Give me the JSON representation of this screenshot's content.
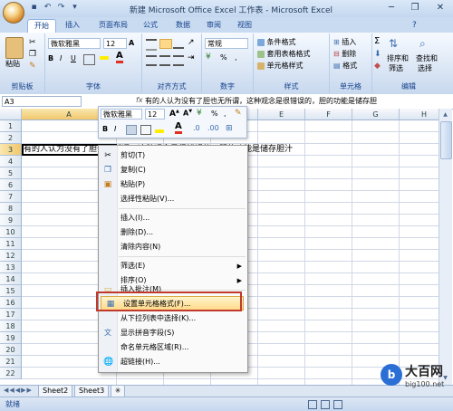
{
  "window": {
    "title": "新建 Microsoft Office Excel 工作表 - Microsoft Excel"
  },
  "qat": [
    "save-icon",
    "undo-icon",
    "redo-icon",
    "dropdown-icon"
  ],
  "tabs": [
    {
      "label": "开始",
      "active": true
    },
    {
      "label": "插入"
    },
    {
      "label": "页面布局"
    },
    {
      "label": "公式"
    },
    {
      "label": "数据"
    },
    {
      "label": "审阅"
    },
    {
      "label": "视图"
    }
  ],
  "ribbon": {
    "clipboard": {
      "label": "剪贴板",
      "paste": "粘贴"
    },
    "font": {
      "label": "字体",
      "name": "微软雅黑",
      "size": "12",
      "bold": "B",
      "italic": "I",
      "underline": "U",
      "grow": "A",
      "shrink": "A"
    },
    "alignment": {
      "label": "对齐方式"
    },
    "number": {
      "label": "数字",
      "format": "常规",
      "percent": "%",
      "comma": ","
    },
    "styles": {
      "label": "样式",
      "cond": "条件格式",
      "table": "套用表格格式",
      "cell": "单元格样式"
    },
    "cells": {
      "label": "单元格",
      "insert": "插入",
      "delete": "删除",
      "format": "格式"
    },
    "editing": {
      "label": "编辑",
      "sort": "排序和",
      "sort2": "筛选",
      "find": "查找和",
      "find2": "选择",
      "sigma": "Σ"
    }
  },
  "formula_bar": {
    "namebox": "A3",
    "fx": "fx",
    "content": "有的人认为没有了胆也无所谓，这种观念是很错误的，胆的功能是储存胆"
  },
  "grid": {
    "columns": [
      "A",
      "B",
      "C",
      "D",
      "E",
      "F",
      "G",
      "H"
    ],
    "rows": [
      "1",
      "2",
      "3",
      "4",
      "5",
      "6",
      "7",
      "8",
      "9",
      "10",
      "11",
      "12",
      "13",
      "14",
      "15",
      "16",
      "17",
      "18",
      "19",
      "20",
      "21",
      "22"
    ],
    "cell_a3": "有的人认为没有了胆也无所谓，这种观念是很错误的，胆的功能是储存胆汁"
  },
  "mini_toolbar": {
    "font": "微软雅黑",
    "size": "12",
    "bold": "B",
    "italic": "I",
    "percent": "%",
    "comma": ","
  },
  "context_menu": [
    {
      "label": "剪切(T)",
      "icon": "scissors-icon"
    },
    {
      "label": "复制(C)",
      "icon": "copy-icon"
    },
    {
      "label": "粘贴(P)",
      "icon": "paste-icon"
    },
    {
      "label": "选择性粘贴(V)...",
      "icon": ""
    },
    {
      "label": "插入(I)...",
      "icon": ""
    },
    {
      "label": "删除(D)...",
      "icon": ""
    },
    {
      "label": "清除内容(N)",
      "icon": ""
    },
    {
      "label": "筛选(E)",
      "icon": "",
      "submenu": true
    },
    {
      "label": "排序(O)",
      "icon": "",
      "submenu": true
    },
    {
      "label": "插入批注(M)",
      "icon": "comment-icon"
    },
    {
      "label": "设置单元格格式(F)...",
      "icon": "format-cells-icon",
      "highlighted": true
    },
    {
      "label": "从下拉列表中选择(K)...",
      "icon": ""
    },
    {
      "label": "显示拼音字段(S)",
      "icon": "pinyin-icon"
    },
    {
      "label": "命名单元格区域(R)...",
      "icon": ""
    },
    {
      "label": "超链接(H)...",
      "icon": "hyperlink-icon"
    }
  ],
  "sheets": [
    "Sheet2",
    "Sheet3"
  ],
  "status": {
    "ready": "就绪"
  },
  "watermark": {
    "brand": "大百网",
    "url": "big100.net"
  },
  "colors": {
    "accent": "#15428b",
    "highlight": "#ffd98a",
    "redbox": "#c0392b"
  }
}
